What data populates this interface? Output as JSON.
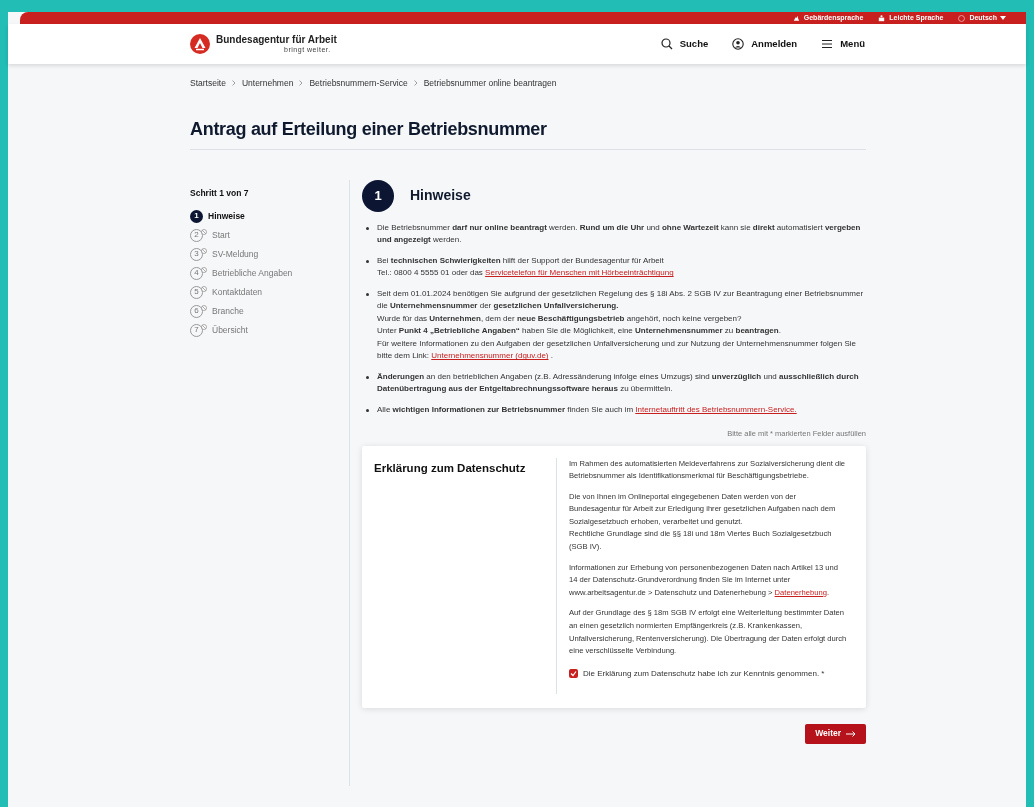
{
  "top_bar": {
    "links": [
      {
        "label": "Gebärdensprache",
        "kind": "sign"
      },
      {
        "label": "Leichte Sprache",
        "kind": "easy"
      },
      {
        "label": "Deutsch",
        "kind": "language"
      }
    ]
  },
  "header": {
    "logo_name": "Bundesagentur für Arbeit",
    "logo_tagline": "bringt weiter.",
    "actions": [
      {
        "label": "Suche",
        "kind": "search"
      },
      {
        "label": "Anmelden",
        "kind": "user"
      },
      {
        "label": "Menü",
        "kind": "menu"
      }
    ]
  },
  "breadcrumb": [
    "Startseite",
    "Unternehmen",
    "Betriebsnummern-Service",
    "Betriebsnummer online beantragen"
  ],
  "page_title": "Antrag auf Erteilung einer Betriebsnummer",
  "stepper": {
    "caption": "Schritt 1 von 7",
    "steps": [
      {
        "number": "1",
        "label": "Hinweise",
        "selected": true
      },
      {
        "number": "2",
        "label": "Start",
        "selected": false
      },
      {
        "number": "3",
        "label": "SV-Meldung",
        "selected": false
      },
      {
        "number": "4",
        "label": "Betriebliche Angaben",
        "selected": false
      },
      {
        "number": "5",
        "label": "Kontaktdaten",
        "selected": false
      },
      {
        "number": "6",
        "label": "Branche",
        "selected": false
      },
      {
        "number": "7",
        "label": "Übersicht",
        "selected": false
      }
    ]
  },
  "section": {
    "number": "1",
    "title": "Hinweise",
    "bullets": [
      {
        "lines": [
          [
            {
              "kind": "text",
              "text": "Die Betriebsnummer **darf nur online beantragt** werden. **Rund um die Uhr** und **ohne Wartezeit** kann sie **direkt** automatisiert **vergeben und angezeigt** werden."
            }
          ]
        ]
      },
      {
        "lines": [
          [
            {
              "kind": "text",
              "text": "Bei **technischen Schwierigkeiten** hilft der Support der Bundesagentur für Arbeit"
            }
          ],
          [
            {
              "kind": "text",
              "text": "Tel.: 0800 4 5555 01 oder das "
            },
            {
              "kind": "link",
              "text": "Servicetelefon für Menschen mit Hörbeeinträchtigung"
            }
          ]
        ]
      },
      {
        "lines": [
          [
            {
              "kind": "text",
              "text": "Seit dem 01.01.2024 benötigen Sie aufgrund der gesetzlichen Regelung des § 18i Abs. 2 SGB IV zur Beantragung einer Betriebsnummer die **Unternehmensnummer** der **gesetzlichen Unfallversicherung.**"
            }
          ],
          [
            {
              "kind": "text",
              "text": "Wurde für das **Unternehmen**, dem der **neue Beschäftigungsbetrieb** angehört, noch keine vergeben?"
            }
          ],
          [
            {
              "kind": "text",
              "text": "Unter **Punkt 4 „Betriebliche Angaben“** haben Sie die Möglichkeit, eine **Unternehmensnummer** zu **beantragen**."
            }
          ],
          [
            {
              "kind": "text",
              "text": "Für weitere Informationen zu den Aufgaben der gesetzlichen Unfallversicherung und zur Nutzung der Unternehmensnummer folgen Sie bitte dem Link: "
            },
            {
              "kind": "link",
              "text": "Unternehmensnummer (dguv.de)"
            },
            {
              "kind": "text",
              "text": " ."
            }
          ]
        ]
      },
      {
        "lines": [
          [
            {
              "kind": "text",
              "text": "**Änderungen** an den betrieblichen Angaben (z.B. Adressänderung infolge eines Umzugs) sind **unverzüglich** und **ausschließlich durch Datenübertragung aus der Entgeltabrechnungssoftware heraus** zu übermitteln."
            }
          ]
        ]
      },
      {
        "lines": [
          [
            {
              "kind": "text",
              "text": "Alle **wichtigen Informationen zur Betriebsnummer** finden Sie auch im "
            },
            {
              "kind": "link",
              "text": "Internetauftritt des Betriebsnummern-Service."
            }
          ]
        ]
      }
    ],
    "required_note": "Bitte alle mit * markierten Felder ausfüllen"
  },
  "privacy": {
    "title": "Erklärung zum Datenschutz",
    "paragraphs": [
      {
        "lines": [
          [
            {
              "kind": "text",
              "text": "Im Rahmen des automatisierten Meldeverfahrens zur Sozialversicherung dient die Betriebsnummer als Identifikationsmerkmal für Beschäftigungsbetriebe."
            }
          ]
        ]
      },
      {
        "lines": [
          [
            {
              "kind": "text",
              "text": "Die von Ihnen im Onlineportal eingegebenen Daten werden von der Bundesagentur für Arbeit zur Erledigung ihrer gesetzlichen Aufgaben nach dem Sozialgesetzbuch erhoben, verarbeitet und genutzt."
            }
          ],
          [
            {
              "kind": "text",
              "text": "Rechtliche Grundlage sind die §§ 18i und 18m Viertes Buch Sozialgesetzbuch (SGB IV)."
            }
          ]
        ]
      },
      {
        "lines": [
          [
            {
              "kind": "text",
              "text": "Informationen zur Erhebung von personenbezogenen Daten nach Artikel 13 und 14 der Datenschutz-Grundverordnung finden Sie im Internet unter www.arbeitsagentur.de > Datenschutz und Datenerhebung > "
            },
            {
              "kind": "link",
              "text": "Datenerhebung"
            },
            {
              "kind": "text",
              "text": "."
            }
          ]
        ]
      },
      {
        "lines": [
          [
            {
              "kind": "text",
              "text": "Auf der Grundlage des § 18m SGB IV erfolgt eine Weiterleitung bestimmter Daten an einen gesetzlich normierten Empfängerkreis (z.B. Krankenkassen, Unfallversicherung, Rentenversicherung). Die Übertragung der Daten erfolgt durch eine verschlüsselte Verbindung."
            }
          ]
        ]
      }
    ],
    "consent": {
      "label": "Die Erklärung zum Datenschutz habe ich zur Kenntnis genommen. *",
      "checked": true
    }
  },
  "next_button": {
    "label": "Weiter"
  }
}
